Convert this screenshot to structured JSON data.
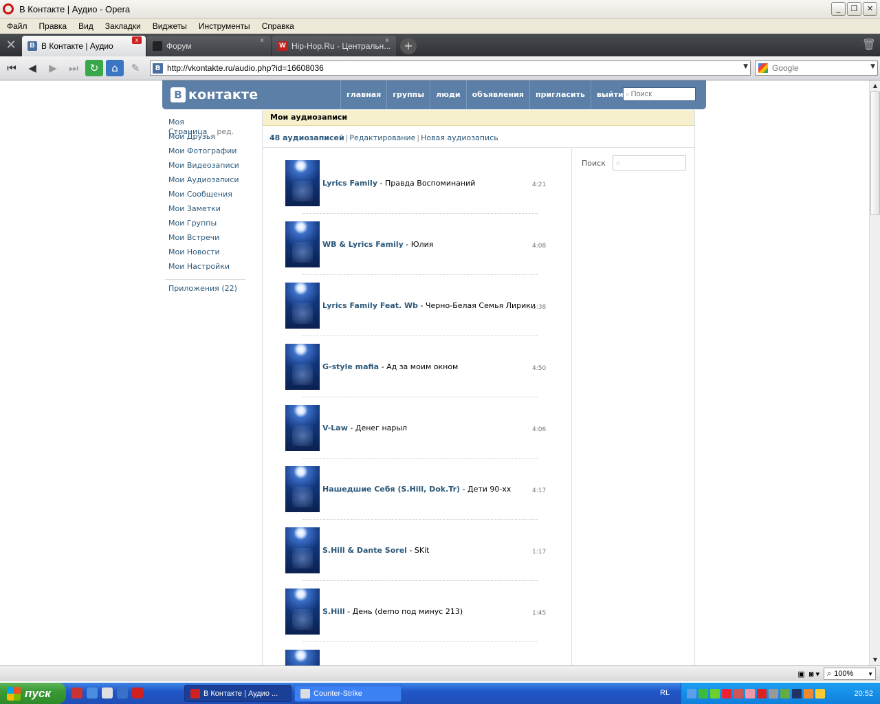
{
  "window": {
    "title": "В Контакте | Аудио - Opera"
  },
  "menu": [
    "Файл",
    "Правка",
    "Вид",
    "Закладки",
    "Виджеты",
    "Инструменты",
    "Справка"
  ],
  "tabs": [
    {
      "label": "В Контакте | Аудио",
      "icon": "vk-icon"
    },
    {
      "label": "Форум",
      "icon": "forum-icon"
    },
    {
      "label": "Hip-Hop.Ru - Центральн...",
      "icon": "hiphop-icon"
    }
  ],
  "address": {
    "url": "http://vkontakte.ru/audio.php?id=16608036"
  },
  "websearch": {
    "placeholder": "Google"
  },
  "vk": {
    "logo": "контакте",
    "nav": [
      "главная",
      "группы",
      "люди",
      "объявления",
      "пригласить",
      "выйти"
    ],
    "search_placeholder": "Поиск",
    "left_menu": [
      "Моя Страница",
      "Мои Друзья",
      "Мои Фотографии",
      "Мои Видеозаписи",
      "Мои Аудиозаписи",
      "Мои Сообщения",
      "Мои Заметки",
      "Мои Группы",
      "Мои Встречи",
      "Мои Новости",
      "Мои Настройки"
    ],
    "edit_label": "ред.",
    "apps_label": "Приложения",
    "apps_count": "(22)",
    "header": "Мои аудиозаписи",
    "summary": {
      "count": "48 аудиозаписей",
      "edit": "Редактирование",
      "new": "Новая аудиозапись"
    },
    "side_search_label": "Поиск",
    "tracks": [
      {
        "artist": "Lyrics Family",
        "title": "Правда Воспоминаний",
        "duration": "4:21"
      },
      {
        "artist": "WB & Lyrics Family",
        "title": "Юлия",
        "duration": "4:08"
      },
      {
        "artist": "Lyrics Family Feat. Wb",
        "title": "Черно-Белая Семья Лирики",
        "duration": "5:38"
      },
      {
        "artist": "G-style mafia",
        "title": "Ад за моим окном",
        "duration": "4:50"
      },
      {
        "artist": "V-Law",
        "title": "Денег нарыл",
        "duration": "4:06"
      },
      {
        "artist": "Нашедшие Себя (S.Hill, Dok.Tr)",
        "title": "Дети 90-хх",
        "duration": "4:17"
      },
      {
        "artist": "S.Hill & Dante Sorel",
        "title": "SKit",
        "duration": "1:17"
      },
      {
        "artist": "S.Hill",
        "title": "День (demo под минус 213)",
        "duration": "1:45"
      }
    ]
  },
  "status": {
    "zoom": "100%"
  },
  "taskbar": {
    "start": "пуск",
    "windows": [
      "В Контакте | Аудио ...",
      "Counter-Strike"
    ],
    "lang": "RL",
    "clock": "20:52"
  }
}
